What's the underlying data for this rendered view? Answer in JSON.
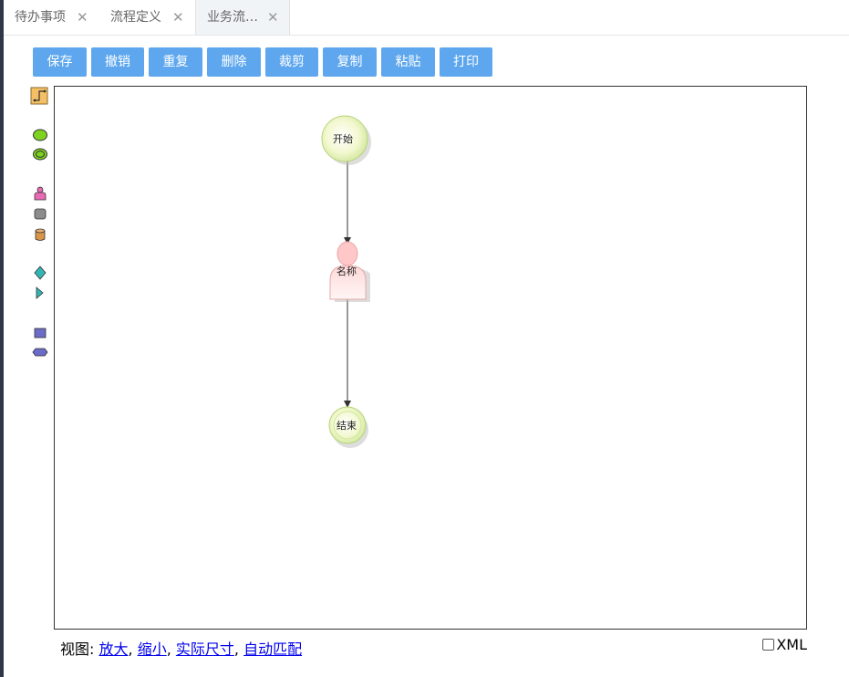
{
  "tabs": [
    {
      "label": "待办事项",
      "close": "✕"
    },
    {
      "label": "流程定义",
      "close": "✕"
    },
    {
      "label": "业务流…",
      "close": "✕"
    }
  ],
  "toolbar": {
    "save": "保存",
    "undo": "撤销",
    "redo": "重复",
    "delete": "删除",
    "cut": "裁剪",
    "copy": "复制",
    "paste": "粘贴",
    "print": "打印"
  },
  "palette": [
    {
      "icon": "connector-icon"
    },
    {
      "icon": "start-event-icon",
      "color": "#7ed321"
    },
    {
      "icon": "end-event-icon",
      "color": "#7ed321"
    },
    {
      "icon": "user-task-icon",
      "color": "#e86ab5"
    },
    {
      "icon": "task-icon",
      "color": "#8c8c8c"
    },
    {
      "icon": "database-icon",
      "color": "#d9954a"
    },
    {
      "icon": "gateway-icon",
      "color": "#33b5b5"
    },
    {
      "icon": "forward-icon",
      "color": "#33b5b5"
    },
    {
      "icon": "subprocess-icon",
      "color": "#6b6bc8"
    },
    {
      "icon": "hexagon-icon",
      "color": "#6b6bc8"
    }
  ],
  "diagram": {
    "start": "开始",
    "task": "名称",
    "end": "结束"
  },
  "footer": {
    "label": "视图:",
    "zoom_in": "放大",
    "zoom_out": "缩小",
    "actual_size": "实际尺寸",
    "fit": "自动匹配",
    "sep": ",",
    "xml": "XML"
  }
}
